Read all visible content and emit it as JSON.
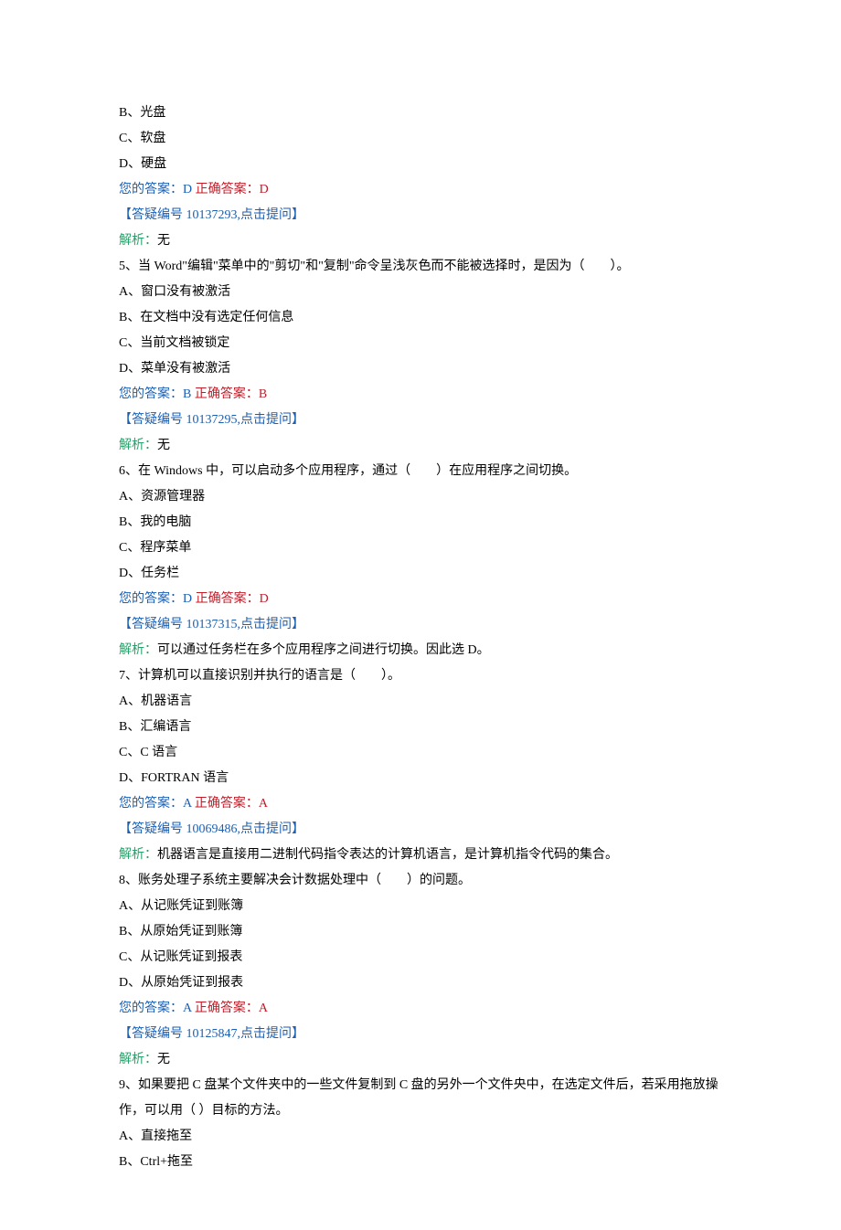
{
  "q4": {
    "options": {
      "B": "B、光盘",
      "C": "C、软盘",
      "D": "D、硬盘"
    },
    "ans_prefix": "您的答案：D ",
    "ans_correct": "正确答案：D",
    "link": "【答疑编号 10137293,点击提问】",
    "analysis_label": "解析：",
    "analysis_text": "无"
  },
  "q5": {
    "question": "5、当 Word\"编辑\"菜单中的\"剪切\"和\"复制\"命令呈浅灰色而不能被选择时，是因为（　　）。",
    "options": {
      "A": "A、窗口没有被激活",
      "B": "B、在文档中没有选定任何信息",
      "C": "C、当前文档被锁定",
      "D": "D、菜单没有被激活"
    },
    "ans_prefix": "您的答案：B ",
    "ans_correct": "正确答案：B",
    "link": "【答疑编号 10137295,点击提问】",
    "analysis_label": "解析：",
    "analysis_text": "无"
  },
  "q6": {
    "question": "6、在 Windows 中，可以启动多个应用程序，通过（　　）在应用程序之间切换。",
    "options": {
      "A": "A、资源管理器",
      "B": "B、我的电脑",
      "C": "C、程序菜单",
      "D": "D、任务栏"
    },
    "ans_prefix": "您的答案：D ",
    "ans_correct": "正确答案：D",
    "link": "【答疑编号 10137315,点击提问】",
    "analysis_label": "解析：",
    "analysis_text": "可以通过任务栏在多个应用程序之间进行切换。因此选 D。"
  },
  "q7": {
    "question": "7、计算机可以直接识别并执行的语言是（　　）。",
    "options": {
      "A": "A、机器语言",
      "B": "B、汇编语言",
      "C": "C、C 语言",
      "D": "D、FORTRAN 语言"
    },
    "ans_prefix": "您的答案：A ",
    "ans_correct": "正确答案：A",
    "link": "【答疑编号 10069486,点击提问】",
    "analysis_label": "解析：",
    "analysis_text": "机器语言是直接用二进制代码指令表达的计算机语言，是计算机指令代码的集合。"
  },
  "q8": {
    "question": "8、账务处理子系统主要解决会计数据处理中（　　）的问题。",
    "options": {
      "A": "A、从记账凭证到账簿",
      "B": "B、从原始凭证到账簿",
      "C": "C、从记账凭证到报表",
      "D": "D、从原始凭证到报表"
    },
    "ans_prefix": "您的答案：A ",
    "ans_correct": "正确答案：A",
    "link": "【答疑编号 10125847,点击提问】",
    "analysis_label": "解析：",
    "analysis_text": "无"
  },
  "q9": {
    "question": "9、如果要把 C 盘某个文件夹中的一些文件复制到 C 盘的另外一个文件央中，在选定文件后，若采用拖放操作，可以用（ ）目标的方法。",
    "options": {
      "A": "A、直接拖至",
      "B": "B、Ctrl+拖至"
    }
  }
}
